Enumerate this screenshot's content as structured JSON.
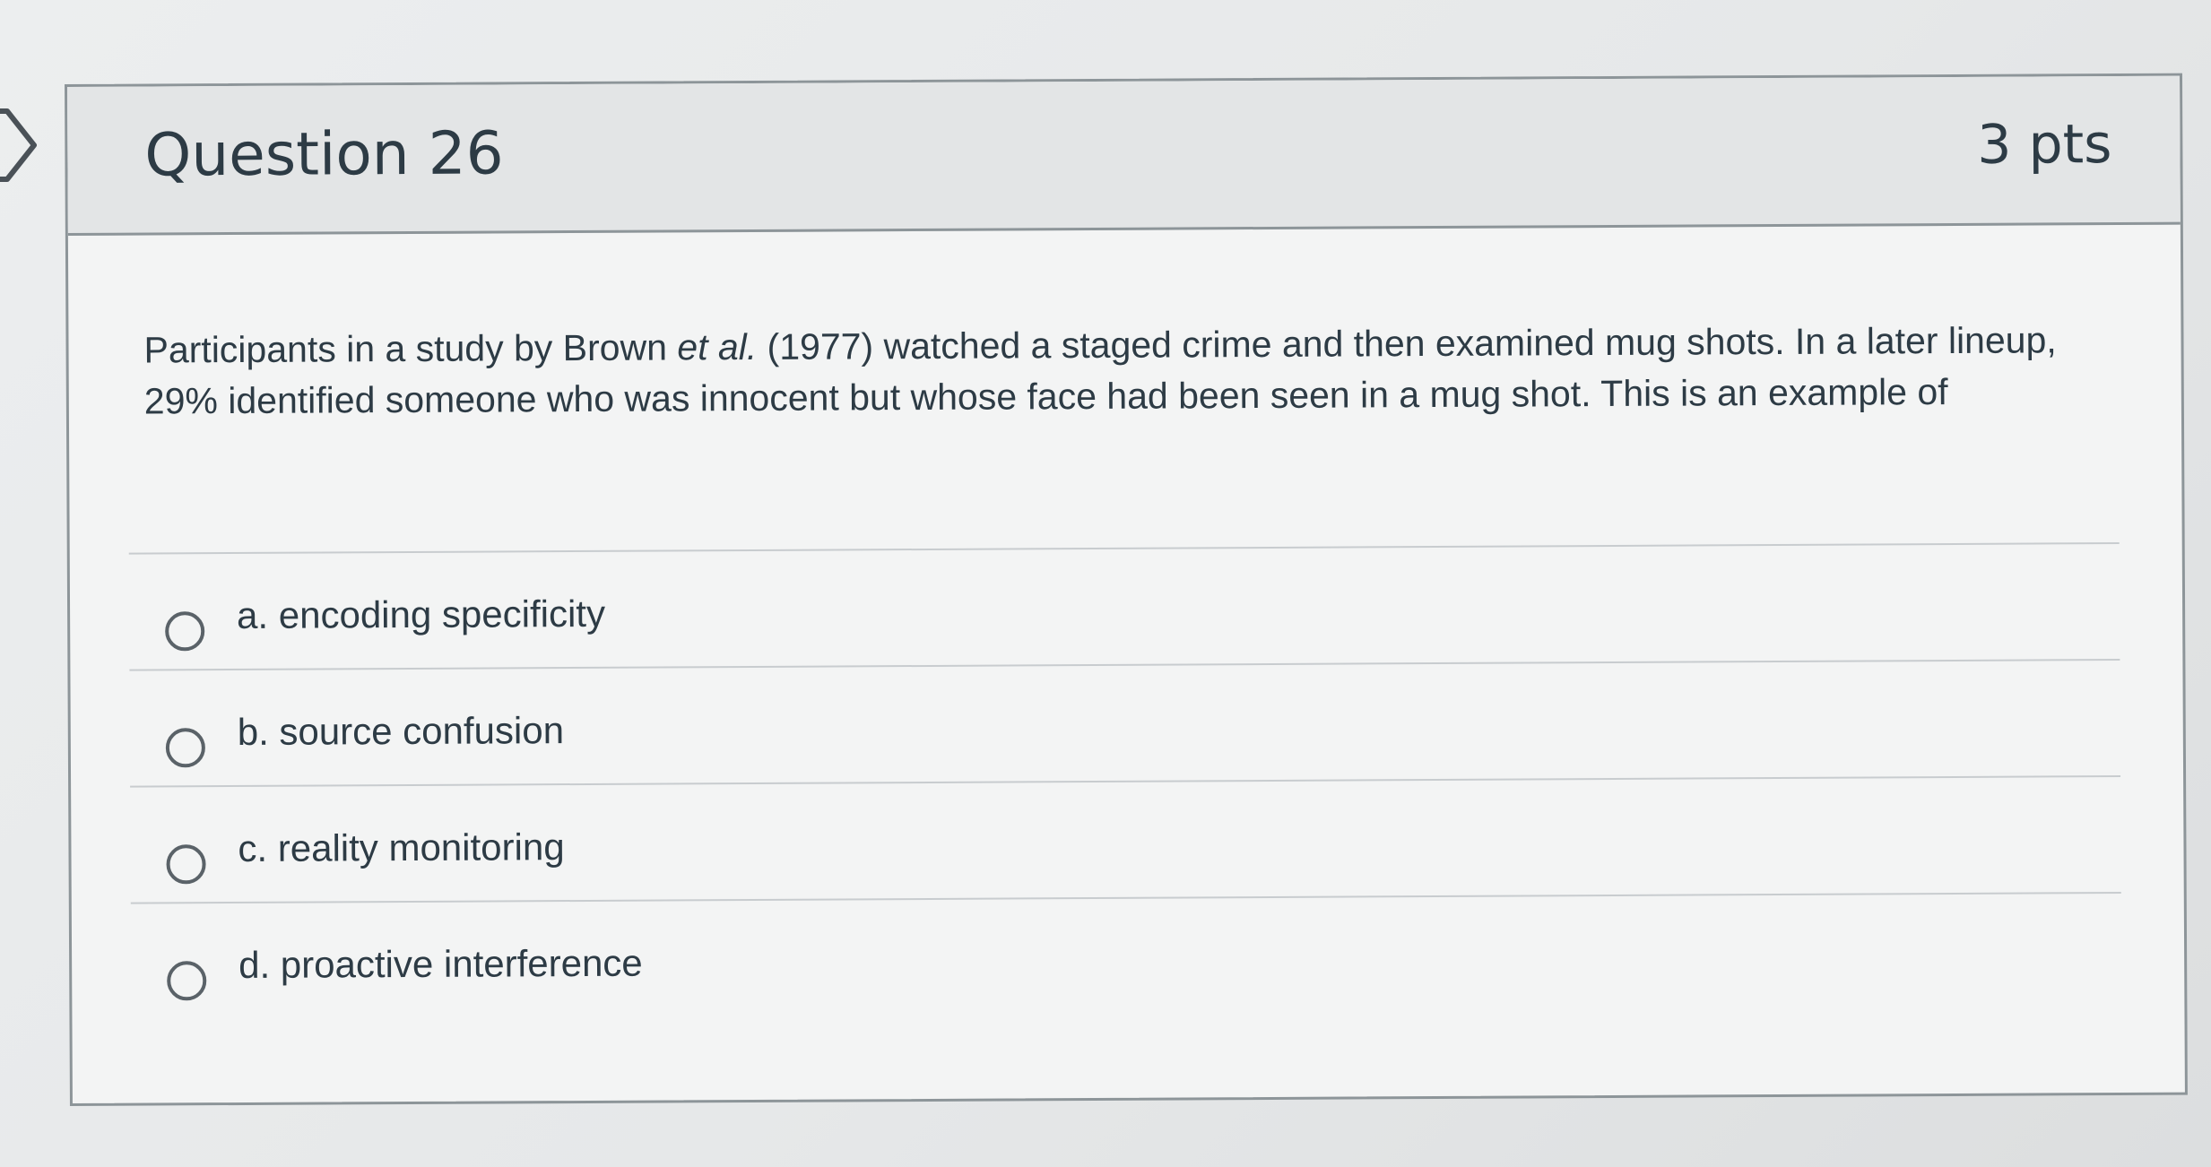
{
  "question": {
    "title": "Question 26",
    "points": "3 pts",
    "text_before": "Participants in a study by Brown ",
    "text_italic": "et al.",
    "text_after": " (1977) watched a staged crime and then examined mug shots. In a later lineup, 29% identified someone who was innocent but whose face had been seen in a mug shot. This is an example of"
  },
  "answers": [
    {
      "label": "a. encoding specificity",
      "selected": false
    },
    {
      "label": "b. source confusion",
      "selected": false
    },
    {
      "label": "c. reality monitoring",
      "selected": false
    },
    {
      "label": "d. proactive interference",
      "selected": false
    }
  ],
  "icons": {
    "nav": "chevron-right-icon",
    "radio": "radio-button-unselected"
  }
}
